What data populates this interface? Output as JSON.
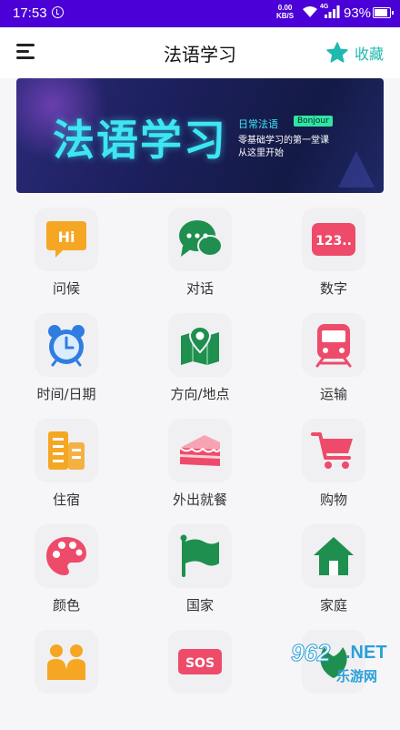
{
  "status": {
    "time": "17:53",
    "speed_top": "0.00",
    "speed_bottom": "KB/S",
    "net": "4G",
    "battery": "93%"
  },
  "header": {
    "title": "法语学习",
    "favorites_label": "收藏"
  },
  "banner": {
    "title": "法语学习",
    "line1": "日常法语",
    "tag": "Bonjour",
    "line2": "零基础学习的第一堂课",
    "line3": "从这里开始"
  },
  "categories": [
    {
      "label": "问候",
      "icon": "hi-bubble-icon",
      "text": "Hi",
      "color": "#f5a623"
    },
    {
      "label": "对话",
      "icon": "chat-bubbles-icon",
      "color": "#1e8f4e"
    },
    {
      "label": "数字",
      "icon": "numbers-icon",
      "text": "123..",
      "color": "#ee4b6a"
    },
    {
      "label": "时间/日期",
      "icon": "alarm-clock-icon",
      "color": "#2f7de1"
    },
    {
      "label": "方向/地点",
      "icon": "map-pin-icon",
      "color": "#1e8f4e"
    },
    {
      "label": "运输",
      "icon": "train-icon",
      "color": "#ee4b6a"
    },
    {
      "label": "住宿",
      "icon": "building-icon",
      "color": "#f5a623"
    },
    {
      "label": "外出就餐",
      "icon": "cake-icon",
      "color": "#ee4b6a"
    },
    {
      "label": "购物",
      "icon": "shopping-cart-icon",
      "color": "#ee4b6a"
    },
    {
      "label": "颜色",
      "icon": "palette-icon",
      "color": "#ee4b6a"
    },
    {
      "label": "国家",
      "icon": "flag-icon",
      "color": "#1e8f4e"
    },
    {
      "label": "家庭",
      "icon": "house-icon",
      "color": "#1e8f4e"
    },
    {
      "label": "",
      "icon": "people-icon",
      "color": "#f5a623"
    },
    {
      "label": "",
      "icon": "sos-icon",
      "text": "SOS",
      "color": "#ee4b6a"
    },
    {
      "label": "",
      "icon": "leaf-icon",
      "color": "#1e8f4e"
    }
  ],
  "watermark": {
    "number": "962",
    "suffix": ".NET",
    "text": "乐游网"
  }
}
